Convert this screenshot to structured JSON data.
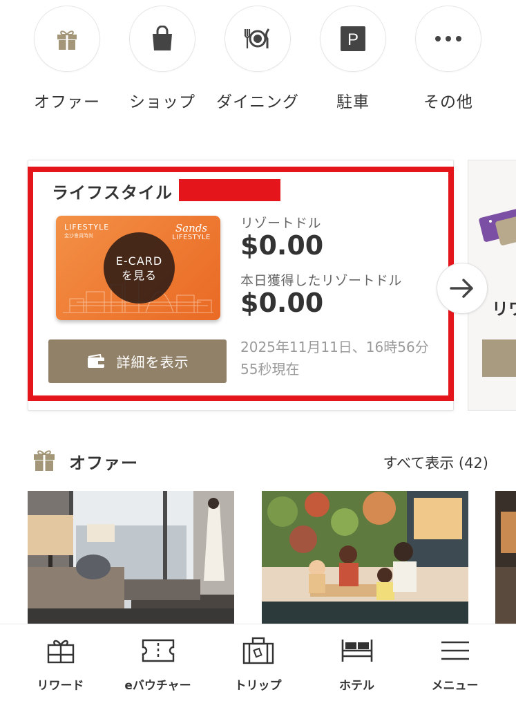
{
  "quick_nav": [
    {
      "label": "オファー",
      "icon": "gift-icon"
    },
    {
      "label": "ショップ",
      "icon": "shopping-bag-icon"
    },
    {
      "label": "ダイニング",
      "icon": "dining-icon"
    },
    {
      "label": "駐車",
      "icon": "parking-icon"
    },
    {
      "label": "その他",
      "icon": "more-icon"
    }
  ],
  "lifestyle_card": {
    "title": "ライフスタイル",
    "ecard_brand": "LIFESTYLE",
    "ecard_brand_sub": "金沙會員時尚",
    "ecard_logo_script": "Sands",
    "ecard_logo_word": "LIFESTYLE",
    "ecard_button_line1": "E-CARD",
    "ecard_button_line2": "を見る",
    "resort_dollars_label": "リゾートドル",
    "resort_dollars_value": "$0.00",
    "today_label": "本日獲得したリゾートドル",
    "today_value": "$0.00",
    "detail_button": "詳細を表示",
    "timestamp": "2025年11月11日、16時56分55秒現在"
  },
  "next_card": {
    "title_partial": "リワ"
  },
  "offers": {
    "title": "オファー",
    "view_all": "すべて表示 (42)"
  },
  "bottom_nav": [
    {
      "label": "リワード",
      "icon": "rewards-icon"
    },
    {
      "label": "eバウチャー",
      "icon": "voucher-icon"
    },
    {
      "label": "トリップ",
      "icon": "luggage-icon"
    },
    {
      "label": "ホテル",
      "icon": "bed-icon"
    },
    {
      "label": "メニュー",
      "icon": "menu-icon"
    }
  ],
  "colors": {
    "accent_gold": "#918168",
    "highlight_red": "#e4161b",
    "card_orange": "#ef7d35"
  }
}
